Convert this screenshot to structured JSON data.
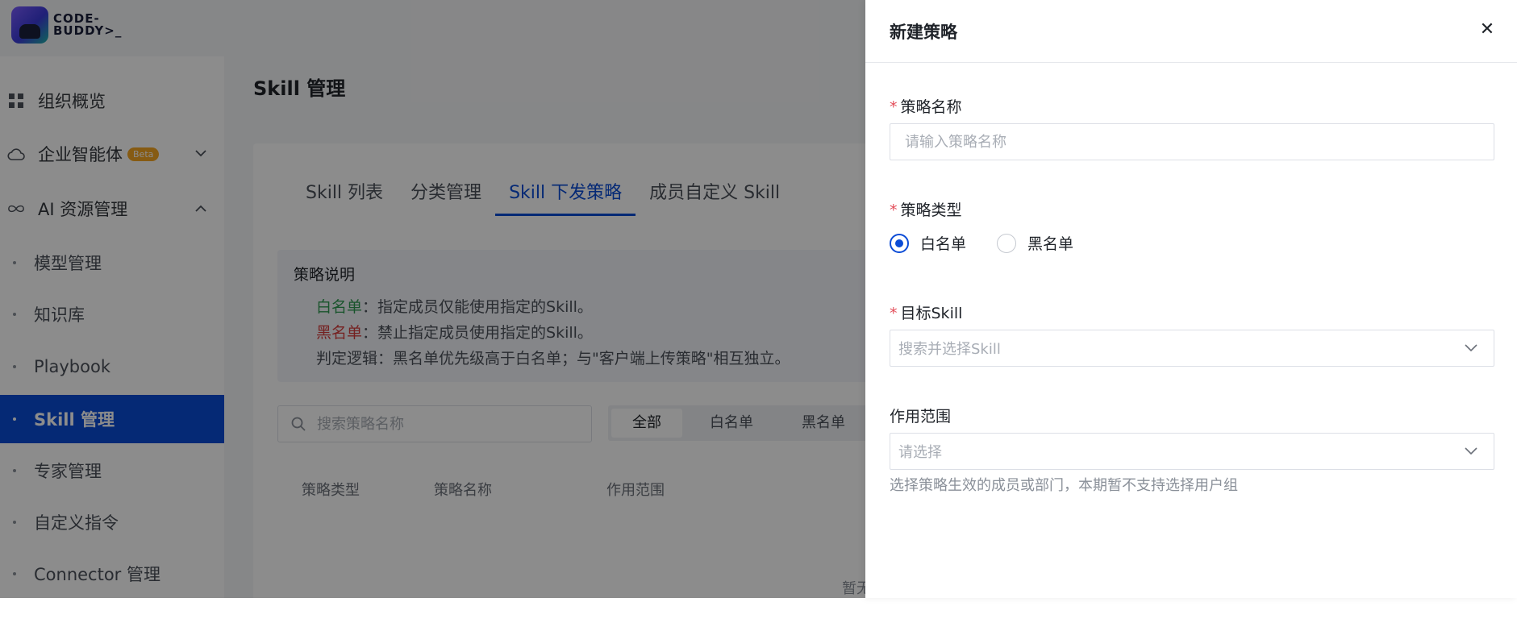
{
  "logo": {
    "line1": "CODE-",
    "line2": "BUDDY>_"
  },
  "sidebar": {
    "items": [
      {
        "label": "组织概览",
        "icon": "grid-icon"
      },
      {
        "label": "企业智能体",
        "icon": "cloud-icon",
        "badge": "Beta",
        "chevron": "down"
      },
      {
        "label": "AI 资源管理",
        "icon": "infinity-icon",
        "chevron": "up"
      }
    ],
    "sub_items": [
      {
        "label": "模型管理"
      },
      {
        "label": "知识库"
      },
      {
        "label": "Playbook"
      },
      {
        "label": "Skill 管理",
        "active": true
      },
      {
        "label": "专家管理"
      },
      {
        "label": "自定义指令"
      },
      {
        "label": "Connector 管理"
      }
    ]
  },
  "main": {
    "title": "Skill 管理",
    "tabs": [
      {
        "label": "Skill 列表"
      },
      {
        "label": "分类管理"
      },
      {
        "label": "Skill 下发策略",
        "active": true
      },
      {
        "label": "成员自定义 Skill"
      }
    ],
    "info": {
      "title": "策略说明",
      "white_key": "白名单",
      "white_text": "：指定成员仅能使用指定的Skill。",
      "black_key": "黑名单",
      "black_text": "：禁止指定成员使用指定的Skill。",
      "logic": "判定逻辑：黑名单优先级高于白名单；与\"客户端上传策略\"相互独立。"
    },
    "search_placeholder": "搜索策略名称",
    "filter": [
      "全部",
      "白名单",
      "黑名单"
    ],
    "columns": [
      "策略类型",
      "策略名称",
      "作用范围"
    ],
    "empty_hint": "暂无"
  },
  "drawer": {
    "title": "新建策略",
    "close_glyph": "✕",
    "name_label": "策略名称",
    "name_placeholder": "请输入策略名称",
    "type_label": "策略类型",
    "type_options": [
      "白名单",
      "黑名单"
    ],
    "type_selected": "白名单",
    "skill_label": "目标Skill",
    "skill_placeholder": "搜索并选择Skill",
    "scope_label": "作用范围",
    "scope_placeholder": "请选择",
    "scope_help": "选择策略生效的成员或部门，本期暂不支持选择用户组",
    "required_mark": "*"
  },
  "colors": {
    "accent": "#0a4bd6",
    "required": "#e34d59",
    "whitelist": "#2f9a51",
    "blacklist": "#d63c3c"
  }
}
